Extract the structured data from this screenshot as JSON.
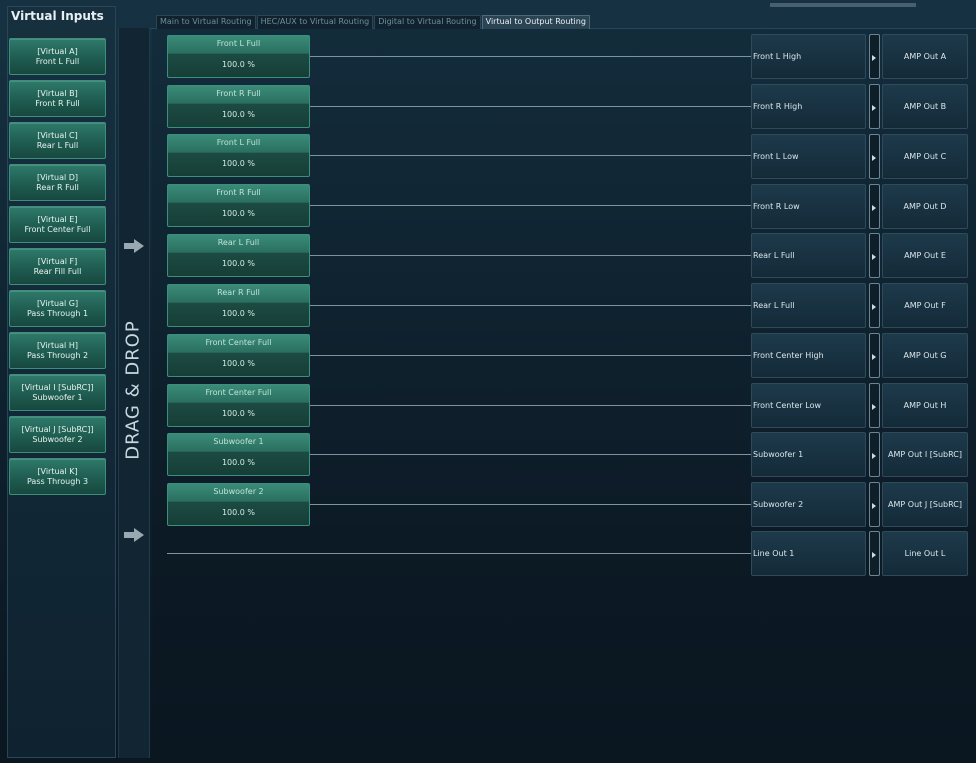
{
  "left_panel": {
    "title": "Virtual Inputs",
    "items": [
      {
        "line1": "[Virtual A]",
        "line2": "Front L Full"
      },
      {
        "line1": "[Virtual B]",
        "line2": "Front R Full"
      },
      {
        "line1": "[Virtual C]",
        "line2": "Rear L Full"
      },
      {
        "line1": "[Virtual D]",
        "line2": "Rear R Full"
      },
      {
        "line1": "[Virtual E]",
        "line2": "Front Center Full"
      },
      {
        "line1": "[Virtual F]",
        "line2": "Rear Fill Full"
      },
      {
        "line1": "[Virtual G]",
        "line2": "Pass Through 1"
      },
      {
        "line1": "[Virtual H]",
        "line2": "Pass Through 2"
      },
      {
        "line1": "[Virtual I [SubRC]]",
        "line2": "Subwoofer 1"
      },
      {
        "line1": "[Virtual J [SubRC]]",
        "line2": "Subwoofer 2"
      },
      {
        "line1": "[Virtual K]",
        "line2": "Pass Through 3"
      }
    ]
  },
  "drag_drop_label": "DRAG & DROP",
  "tabs": [
    {
      "label": "Main to Virtual Routing",
      "active": false
    },
    {
      "label": "HEC/AUX to Virtual Routing",
      "active": false
    },
    {
      "label": "Digital to Virtual Routing",
      "active": false
    },
    {
      "label": "Virtual to Output Routing",
      "active": true
    }
  ],
  "routes": [
    {
      "source": "Front L Full",
      "level": "100.0 %",
      "output": "Front L High",
      "amp": "AMP Out A"
    },
    {
      "source": "Front R Full",
      "level": "100.0 %",
      "output": "Front R High",
      "amp": "AMP Out B"
    },
    {
      "source": "Front L Full",
      "level": "100.0 %",
      "output": "Front L Low",
      "amp": "AMP Out C"
    },
    {
      "source": "Front R Full",
      "level": "100.0 %",
      "output": "Front R Low",
      "amp": "AMP Out D"
    },
    {
      "source": "Rear L Full",
      "level": "100.0 %",
      "output": "Rear L Full",
      "amp": "AMP Out E"
    },
    {
      "source": "Rear R Full",
      "level": "100.0 %",
      "output": "Rear L Full",
      "amp": "AMP Out F"
    },
    {
      "source": "Front Center Full",
      "level": "100.0 %",
      "output": "Front Center High",
      "amp": "AMP Out G"
    },
    {
      "source": "Front Center Full",
      "level": "100.0 %",
      "output": "Front Center Low",
      "amp": "AMP Out H"
    },
    {
      "source": "Subwoofer 1",
      "level": "100.0 %",
      "output": "Subwoofer 1",
      "amp": "AMP Out I [SubRC]"
    },
    {
      "source": "Subwoofer 2",
      "level": "100.0 %",
      "output": "Subwoofer 2",
      "amp": "AMP Out J [SubRC]"
    },
    {
      "source": null,
      "level": null,
      "output": "Line Out 1",
      "amp": "Line Out L"
    }
  ],
  "colors": {
    "background": "#0b1722",
    "source_block": "#2a6f60",
    "wire": "#7f939c"
  }
}
